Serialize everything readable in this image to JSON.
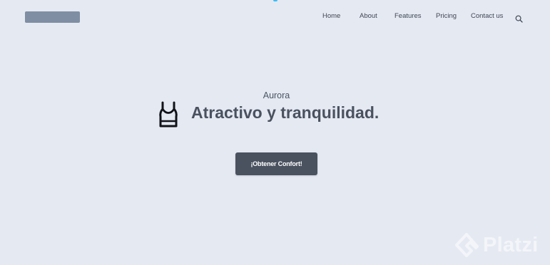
{
  "nav": {
    "items": [
      {
        "label": "Home"
      },
      {
        "label": "About"
      },
      {
        "label": "Features"
      },
      {
        "label": "Pricing"
      },
      {
        "label": "Contact us"
      }
    ],
    "search_icon": "search-icon"
  },
  "hero": {
    "kicker": "Aurora",
    "title": "Atractivo y tranquilidad.",
    "icon": "tank-top-icon",
    "cta_label": "¡Obtener Confort!"
  },
  "watermark": {
    "text": "Platzi"
  },
  "colors": {
    "background": "#e5e9f2",
    "logo_placeholder": "#7f8ea3",
    "button": "#4a5260",
    "text_dark": "#4a5260",
    "accent": "#38bdf8"
  }
}
